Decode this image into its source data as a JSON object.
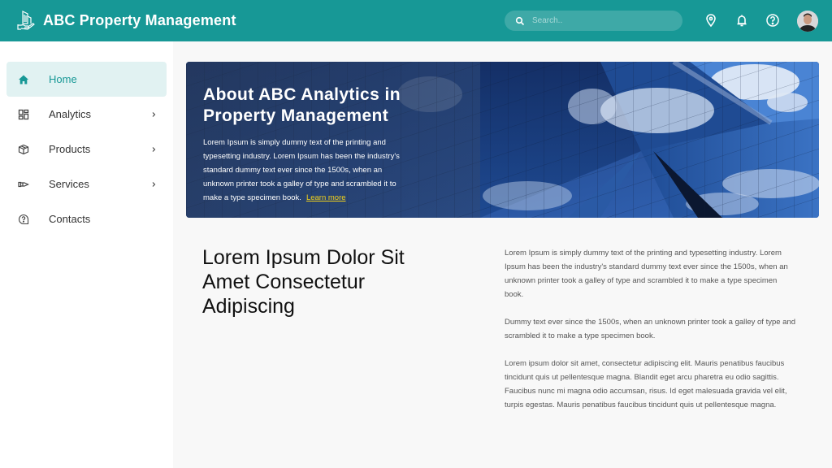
{
  "header": {
    "title": "ABC Property Management",
    "logo_icon": "building-hand-icon",
    "search": {
      "placeholder": "Search..",
      "value": ""
    },
    "icons": [
      "location-pin-icon",
      "bell-icon",
      "help-circle-icon"
    ],
    "avatar": "user-avatar"
  },
  "sidebar": {
    "items": [
      {
        "label": "Home",
        "icon": "home-icon",
        "active": true,
        "has_submenu": false
      },
      {
        "label": "Analytics",
        "icon": "dashboard-grid-icon",
        "active": false,
        "has_submenu": true
      },
      {
        "label": "Products",
        "icon": "box-icon",
        "active": false,
        "has_submenu": true
      },
      {
        "label": "Services",
        "icon": "hand-service-icon",
        "active": false,
        "has_submenu": true
      },
      {
        "label": "Contacts",
        "icon": "help-circle-icon",
        "active": false,
        "has_submenu": false
      }
    ]
  },
  "hero": {
    "title": "About ABC Analytics in Property Management",
    "body": "Lorem Ipsum is simply dummy text of the printing and typesetting industry. Lorem Ipsum has been the industry's standard dummy text ever since the 1500s, when an unknown printer took a galley of type and scrambled it to make a type specimen book.",
    "link_label": "Learn more",
    "image": "glass-building-reflecting-clouds"
  },
  "content": {
    "heading": "Lorem Ipsum Dolor Sit Amet Consectetur Adipiscing",
    "paragraphs": [
      "Lorem Ipsum is simply dummy text of the printing and typesetting industry. Lorem Ipsum has been the industry's standard dummy text ever since the 1500s, when an unknown printer took a galley of type and scrambled it to make a type specimen book.",
      "Dummy text ever since the 1500s, when an unknown printer took a galley of type and scrambled it to make a type specimen book.",
      "Lorem ipsum dolor sit amet, consectetur adipiscing elit. Mauris penatibus faucibus tincidunt quis ut pellentesque magna. Blandit eget arcu pharetra eu odio sagittis. Faucibus nunc mi magna odio accumsan, risus. Id eget malesuada gravida vel elit, turpis egestas.  Mauris penatibus faucibus tincidunt quis ut pellentesque magna."
    ]
  },
  "colors": {
    "brand": "#179896",
    "active_bg": "#e1f2f2",
    "link": "#f3d21a"
  }
}
